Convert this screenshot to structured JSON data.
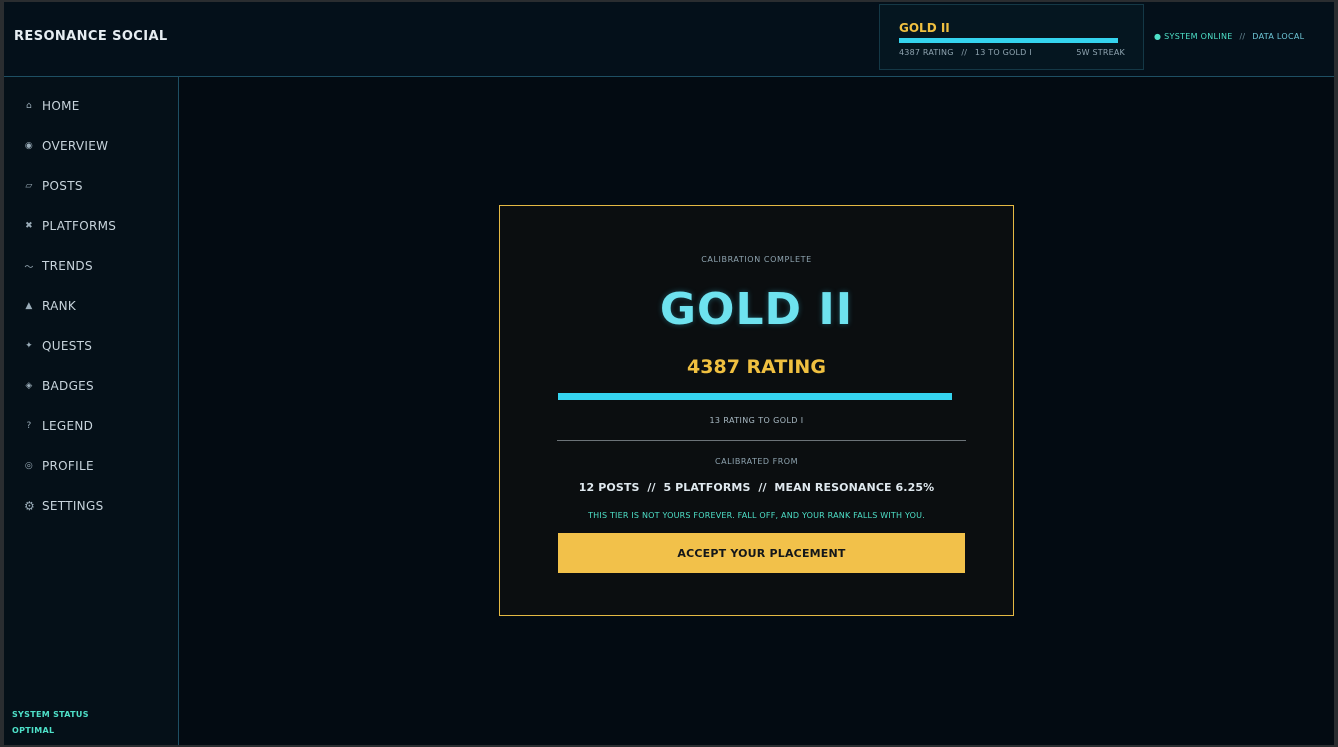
{
  "header": {
    "brand": "RESONANCE SOCIAL",
    "rank": {
      "tier": "GOLD II",
      "progress": 1.0,
      "rating_text": "4387 RATING",
      "sep": "//",
      "to_next": "13 TO GOLD I",
      "streak": "5W STREAK"
    },
    "system": {
      "online": "● SYSTEM ONLINE",
      "sep": "//",
      "data": "DATA LOCAL"
    }
  },
  "sidebar": {
    "items": [
      {
        "icon": "⌂",
        "label": "HOME"
      },
      {
        "icon": "◉",
        "label": "OVERVIEW"
      },
      {
        "icon": "▱",
        "label": "POSTS"
      },
      {
        "icon": "✖",
        "label": "PLATFORMS"
      },
      {
        "icon": "〜",
        "label": "TRENDS"
      },
      {
        "icon": "▲",
        "label": "RANK"
      },
      {
        "icon": "✦",
        "label": "QUESTS"
      },
      {
        "icon": "◈",
        "label": "BADGES"
      },
      {
        "icon": "?",
        "label": "LEGEND"
      },
      {
        "icon": "◎",
        "label": "PROFILE"
      },
      {
        "icon": "⚙",
        "label": "SETTINGS"
      }
    ],
    "status_line1": "SYSTEM STATUS",
    "status_line2": "OPTIMAL"
  },
  "modal": {
    "eyebrow": "CALIBRATION COMPLETE",
    "tier": "GOLD II",
    "rating": "4387 RATING",
    "progress": 1.0,
    "to_next": "13 RATING TO GOLD I",
    "calibrated_from": "CALIBRATED FROM",
    "stats": "12 POSTS  //  5 PLATFORMS  //  MEAN RESONANCE 6.25%",
    "warning": "THIS TIER IS NOT YOURS FOREVER. FALL OFF, AND YOUR RANK FALLS WITH YOU.",
    "accept_label": "ACCEPT YOUR PLACEMENT"
  },
  "colors": {
    "accent_cyan": "#35d4ef",
    "accent_gold": "#f0c040",
    "background": "#030b12"
  }
}
